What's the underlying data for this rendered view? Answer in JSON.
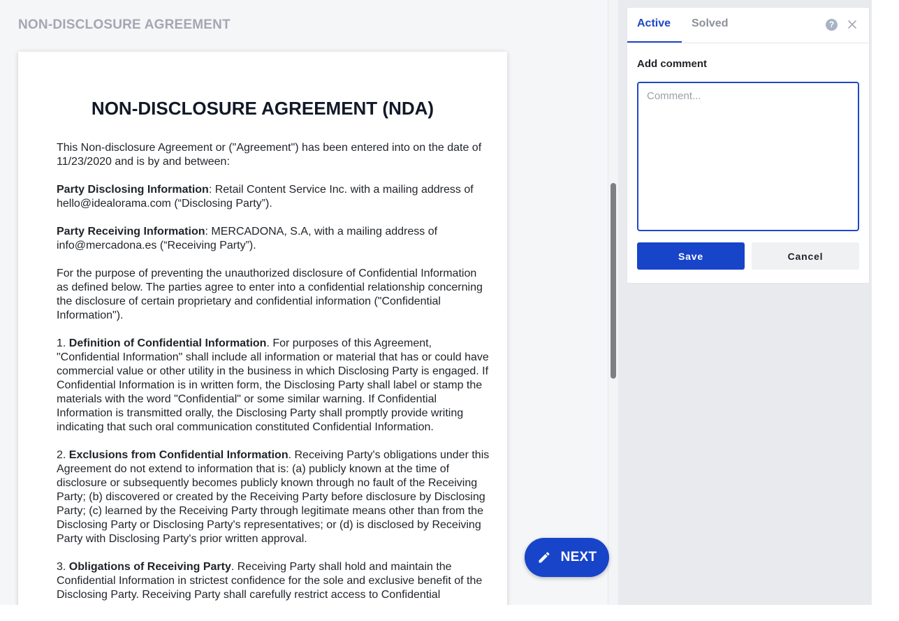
{
  "document": {
    "header": "NON-DISCLOSURE AGREEMENT",
    "title": "NON-DISCLOSURE AGREEMENT (NDA)",
    "paragraphs": [
      {
        "bold": "",
        "text": "This Non-disclosure Agreement or (\"Agreement\") has been entered into on the date of 11/23/2020 and is by and between:"
      },
      {
        "bold": "Party Disclosing Information",
        "text": ": Retail Content Service Inc. with a mailing address of hello@idealorama.com (“Disclosing Party”)."
      },
      {
        "bold": "Party Receiving Information",
        "text": ": MERCADONA, S.A, with a mailing address of info@mercadona.es (“Receiving Party”)."
      },
      {
        "bold": "",
        "text": "For the purpose of preventing the unauthorized disclosure of Confidential Information as defined below. The parties agree to enter into a confidential relationship concerning the disclosure of certain proprietary and confidential information (\"Confidential Information\")."
      },
      {
        "prefix": "1. ",
        "bold": "Definition of Confidential Information",
        "text": ". For purposes of this Agreement, \"Confidential Information\" shall include all information or material that has or could have commercial value or other utility in the business in which Disclosing Party is engaged. If Confidential Information is in written form, the Disclosing Party shall label or stamp the materials with the word \"Confidential\" or some similar warning. If Confidential Information is transmitted orally, the Disclosing Party shall promptly provide writing indicating that such oral communication constituted Confidential Information."
      },
      {
        "prefix": "2. ",
        "bold": "Exclusions from Confidential Information",
        "text": ". Receiving Party's obligations under this Agreement do not extend to information that is: (a) publicly known at the time of disclosure or subsequently becomes publicly known through no fault of the Receiving Party; (b) discovered or created by the Receiving Party before disclosure by Disclosing Party; (c) learned by the Receiving Party through legitimate means other than from the Disclosing Party or Disclosing Party's representatives; or (d) is disclosed by Receiving Party with Disclosing Party's prior written approval."
      },
      {
        "prefix": "3. ",
        "bold": "Obligations of Receiving Party",
        "text": ". Receiving Party shall hold and maintain the Confidential Information in strictest confidence for the sole and exclusive benefit of the Disclosing Party. Receiving Party shall carefully restrict access to Confidential"
      }
    ]
  },
  "fab": {
    "label": "NEXT",
    "icon": "pencil-icon",
    "color": "#1744c9"
  },
  "comments_panel": {
    "tabs": [
      "Active",
      "Solved"
    ],
    "active_tab": "Active",
    "add_comment_label": "Add comment",
    "input_placeholder": "Comment...",
    "input_value": "",
    "save_label": "Save",
    "cancel_label": "Cancel",
    "help_icon": "?",
    "accent_color": "#1f47c8"
  }
}
